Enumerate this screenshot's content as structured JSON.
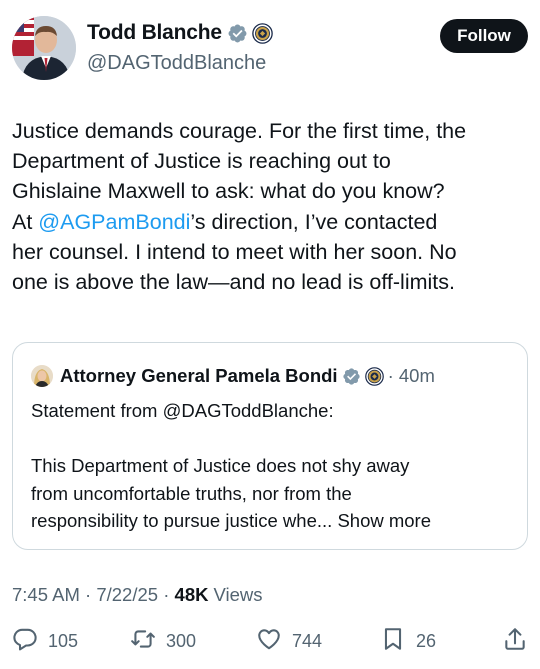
{
  "author": {
    "name": "Todd Blanche",
    "handle": "@DAGToddBlanche",
    "follow_label": "Follow"
  },
  "tweet": {
    "lines": [
      "Justice demands courage. For the first time, the",
      "Department of Justice is reaching out to",
      "Ghislaine Maxwell to ask: what do you know?",
      "’s direction, I’ve contacted",
      "her counsel. I intend to meet with her soon. No",
      "one is above the law—and no lead is off-limits."
    ],
    "line4_prefix": "At ",
    "mention": "@AGPamBondi"
  },
  "quote": {
    "name": "Attorney General Pamela Bondi",
    "time": "· 40m",
    "line1": "Statement from @DAGToddBlanche:",
    "line2": "This Department of Justice does not shy away",
    "line3": "from uncomfortable truths, nor from the",
    "line4": "responsibility to pursue justice whe...",
    "show_more": "Show more"
  },
  "meta": {
    "time": "7:45 AM",
    "separator1": " · ",
    "date": "7/22/25",
    "separator2": " · ",
    "views_count": "48K",
    "views_label": "Views"
  },
  "actions": {
    "replies": "105",
    "reposts": "300",
    "likes": "744",
    "bookmarks": "26"
  },
  "icons": {
    "verified": "verified-badge-icon",
    "seal": "doj-seal-icon",
    "reply": "reply-icon",
    "repost": "repost-icon",
    "like": "heart-icon",
    "bookmark": "bookmark-icon",
    "share": "share-icon"
  },
  "colors": {
    "accent": "#1d9bf0",
    "text": "#0f1419",
    "muted": "#536471",
    "border": "#cfd9de"
  }
}
